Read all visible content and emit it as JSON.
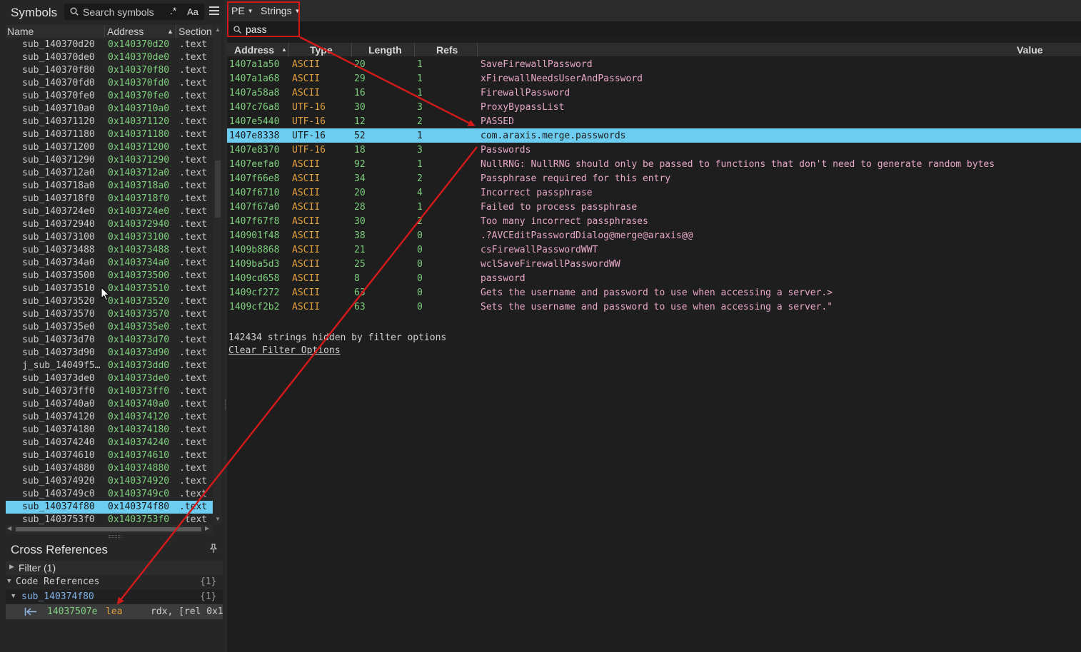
{
  "symbols_panel": {
    "title": "Symbols",
    "search_placeholder": "Search symbols",
    "regex_glyph": ".*",
    "case_glyph": "Aa",
    "columns": [
      "Name",
      "Address",
      "Section"
    ],
    "rows": [
      {
        "name": "sub_140370d20",
        "address": "0x140370d20",
        "section": ".text"
      },
      {
        "name": "sub_140370de0",
        "address": "0x140370de0",
        "section": ".text"
      },
      {
        "name": "sub_140370f80",
        "address": "0x140370f80",
        "section": ".text"
      },
      {
        "name": "sub_140370fd0",
        "address": "0x140370fd0",
        "section": ".text"
      },
      {
        "name": "sub_140370fe0",
        "address": "0x140370fe0",
        "section": ".text"
      },
      {
        "name": "sub_1403710a0",
        "address": "0x1403710a0",
        "section": ".text"
      },
      {
        "name": "sub_140371120",
        "address": "0x140371120",
        "section": ".text"
      },
      {
        "name": "sub_140371180",
        "address": "0x140371180",
        "section": ".text"
      },
      {
        "name": "sub_140371200",
        "address": "0x140371200",
        "section": ".text"
      },
      {
        "name": "sub_140371290",
        "address": "0x140371290",
        "section": ".text"
      },
      {
        "name": "sub_1403712a0",
        "address": "0x1403712a0",
        "section": ".text"
      },
      {
        "name": "sub_1403718a0",
        "address": "0x1403718a0",
        "section": ".text"
      },
      {
        "name": "sub_1403718f0",
        "address": "0x1403718f0",
        "section": ".text"
      },
      {
        "name": "sub_1403724e0",
        "address": "0x1403724e0",
        "section": ".text"
      },
      {
        "name": "sub_140372940",
        "address": "0x140372940",
        "section": ".text"
      },
      {
        "name": "sub_140373100",
        "address": "0x140373100",
        "section": ".text"
      },
      {
        "name": "sub_140373488",
        "address": "0x140373488",
        "section": ".text"
      },
      {
        "name": "sub_1403734a0",
        "address": "0x1403734a0",
        "section": ".text"
      },
      {
        "name": "sub_140373500",
        "address": "0x140373500",
        "section": ".text"
      },
      {
        "name": "sub_140373510",
        "address": "0x140373510",
        "section": ".text"
      },
      {
        "name": "sub_140373520",
        "address": "0x140373520",
        "section": ".text"
      },
      {
        "name": "sub_140373570",
        "address": "0x140373570",
        "section": ".text"
      },
      {
        "name": "sub_1403735e0",
        "address": "0x1403735e0",
        "section": ".text"
      },
      {
        "name": "sub_140373d70",
        "address": "0x140373d70",
        "section": ".text"
      },
      {
        "name": "sub_140373d90",
        "address": "0x140373d90",
        "section": ".text"
      },
      {
        "name": "j_sub_14049f5…",
        "address": "0x140373dd0",
        "section": ".text"
      },
      {
        "name": "sub_140373de0",
        "address": "0x140373de0",
        "section": ".text"
      },
      {
        "name": "sub_140373ff0",
        "address": "0x140373ff0",
        "section": ".text"
      },
      {
        "name": "sub_1403740a0",
        "address": "0x1403740a0",
        "section": ".text"
      },
      {
        "name": "sub_140374120",
        "address": "0x140374120",
        "section": ".text"
      },
      {
        "name": "sub_140374180",
        "address": "0x140374180",
        "section": ".text"
      },
      {
        "name": "sub_140374240",
        "address": "0x140374240",
        "section": ".text"
      },
      {
        "name": "sub_140374610",
        "address": "0x140374610",
        "section": ".text"
      },
      {
        "name": "sub_140374880",
        "address": "0x140374880",
        "section": ".text"
      },
      {
        "name": "sub_140374920",
        "address": "0x140374920",
        "section": ".text"
      },
      {
        "name": "sub_1403749c0",
        "address": "0x1403749c0",
        "section": ".text"
      },
      {
        "name": "sub_140374f80",
        "address": "0x140374f80",
        "section": ".text",
        "selected": true
      },
      {
        "name": "sub_1403753f0",
        "address": "0x1403753f0",
        "section": ".text"
      }
    ]
  },
  "xref_panel": {
    "title": "Cross References",
    "filter_label": "Filter (1)",
    "code_refs_label": "Code References",
    "code_refs_count": "{1}",
    "function_name": "sub_140374f80",
    "function_count": "{1}",
    "entry_address": "14037507e",
    "entry_mnemonic": "lea",
    "entry_operands": "rdx, [rel 0x1"
  },
  "strings_view": {
    "pe_label": "PE",
    "view_label": "Strings",
    "filter_value": "pass",
    "columns": [
      "Address",
      "Type",
      "Length",
      "Refs",
      "Value"
    ],
    "rows": [
      {
        "address": "1407a1a50",
        "type": "ASCII",
        "length": "20",
        "refs": "1",
        "value": "SaveFirewallPassword"
      },
      {
        "address": "1407a1a68",
        "type": "ASCII",
        "length": "29",
        "refs": "1",
        "value": "xFirewallNeedsUserAndPassword"
      },
      {
        "address": "1407a58a8",
        "type": "ASCII",
        "length": "16",
        "refs": "1",
        "value": "FirewallPassword"
      },
      {
        "address": "1407c76a8",
        "type": "UTF-16",
        "length": "30",
        "refs": "3",
        "value": "ProxyBypassList"
      },
      {
        "address": "1407e5440",
        "type": "UTF-16",
        "length": "12",
        "refs": "2",
        "value": "PASSED"
      },
      {
        "address": "1407e8338",
        "type": "UTF-16",
        "length": "52",
        "refs": "1",
        "value": "com.araxis.merge.passwords",
        "selected": true
      },
      {
        "address": "1407e8370",
        "type": "UTF-16",
        "length": "18",
        "refs": "3",
        "value": "Passwords"
      },
      {
        "address": "1407eefa0",
        "type": "ASCII",
        "length": "92",
        "refs": "1",
        "value": "NullRNG: NullRNG should only be passed to functions that don't need to generate random bytes"
      },
      {
        "address": "1407f66e8",
        "type": "ASCII",
        "length": "34",
        "refs": "2",
        "value": "Passphrase required for this entry"
      },
      {
        "address": "1407f6710",
        "type": "ASCII",
        "length": "20",
        "refs": "4",
        "value": "Incorrect passphrase"
      },
      {
        "address": "1407f67a0",
        "type": "ASCII",
        "length": "28",
        "refs": "1",
        "value": "Failed to process passphrase"
      },
      {
        "address": "1407f67f8",
        "type": "ASCII",
        "length": "30",
        "refs": "2",
        "value": "Too many incorrect passphrases"
      },
      {
        "address": "140901f48",
        "type": "ASCII",
        "length": "38",
        "refs": "0",
        "value": ".?AVCEditPasswordDialog@merge@araxis@@"
      },
      {
        "address": "1409b8868",
        "type": "ASCII",
        "length": "21",
        "refs": "0",
        "value": "csFirewallPasswordWWT"
      },
      {
        "address": "1409ba5d3",
        "type": "ASCII",
        "length": "25",
        "refs": "0",
        "value": "wclSaveFirewallPasswordWW"
      },
      {
        "address": "1409cd658",
        "type": "ASCII",
        "length": "8",
        "refs": "0",
        "value": "password"
      },
      {
        "address": "1409cf272",
        "type": "ASCII",
        "length": "63",
        "refs": "0",
        "value": "Gets the username and password to use when accessing a server.>"
      },
      {
        "address": "1409cf2b2",
        "type": "ASCII",
        "length": "63",
        "refs": "0",
        "value": "Sets the username and password to use when accessing a server.\""
      }
    ],
    "hidden_message": "142434 strings hidden by filter options",
    "clear_link": "Clear Filter Options"
  },
  "colors": {
    "selection": "#6ccdf0",
    "address_green": "#7fcf7f",
    "type_orange": "#e0a040",
    "value_pink": "#e8a8c8",
    "annotation_red": "#d01a1a"
  }
}
